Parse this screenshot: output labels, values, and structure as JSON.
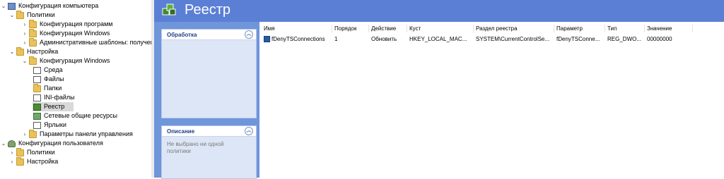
{
  "tree": {
    "items": [
      {
        "label": "Конфигурация компьютера",
        "icon": "computer-icon",
        "chev": "expanded"
      },
      {
        "label": "Политики",
        "icon": "folder-icon",
        "chev": "expanded"
      },
      {
        "label": "Конфигурация программ",
        "icon": "folder-icon",
        "chev": "collapsed"
      },
      {
        "label": "Конфигурация Windows",
        "icon": "folder-icon",
        "chev": "collapsed"
      },
      {
        "label": "Административные шаблоны: получен",
        "icon": "folder-icon",
        "chev": "collapsed"
      },
      {
        "label": "Настройка",
        "icon": "folder-icon",
        "chev": "expanded"
      },
      {
        "label": "Конфигурация Windows",
        "icon": "folder-icon",
        "chev": "expanded"
      },
      {
        "label": "Среда",
        "icon": "environment-icon",
        "chev": ""
      },
      {
        "label": "Файлы",
        "icon": "files-icon",
        "chev": ""
      },
      {
        "label": "Папки",
        "icon": "folder-icon",
        "chev": ""
      },
      {
        "label": "INI-файлы",
        "icon": "ini-file-icon",
        "chev": ""
      },
      {
        "label": "Реестр",
        "icon": "registry-icon",
        "chev": "",
        "selected": true
      },
      {
        "label": "Сетевые общие ресурсы",
        "icon": "network-share-icon",
        "chev": ""
      },
      {
        "label": "Ярлыки",
        "icon": "shortcut-icon",
        "chev": ""
      },
      {
        "label": "Параметры панели управления",
        "icon": "control-panel-icon",
        "chev": "collapsed"
      },
      {
        "label": "Конфигурация пользователя",
        "icon": "user-icon",
        "chev": "expanded"
      },
      {
        "label": "Политики",
        "icon": "folder-icon",
        "chev": "collapsed"
      },
      {
        "label": "Настройка",
        "icon": "folder-icon",
        "chev": "collapsed"
      }
    ]
  },
  "header": {
    "title": "Реестр"
  },
  "panels": {
    "processing": {
      "title": "Обработка"
    },
    "description": {
      "title": "Описание",
      "text": "Не выбрано ни одной политики"
    }
  },
  "table": {
    "columns": [
      "Имя",
      "Порядок",
      "Действие",
      "Куст",
      "Раздел реестра",
      "Параметр",
      "Тип",
      "Значение"
    ],
    "rows": [
      [
        "fDenyTSConnections",
        "1",
        "Обновить",
        "HKEY_LOCAL_MAC...",
        "SYSTEM\\CurrentControlSe...",
        "fDenyTSConne...",
        "REG_DWO...",
        "00000000"
      ]
    ]
  },
  "colors": {
    "header_bg": "#5b7fd5",
    "sidebar_bg": "#6f95db",
    "accent": "#1f3f8a"
  }
}
